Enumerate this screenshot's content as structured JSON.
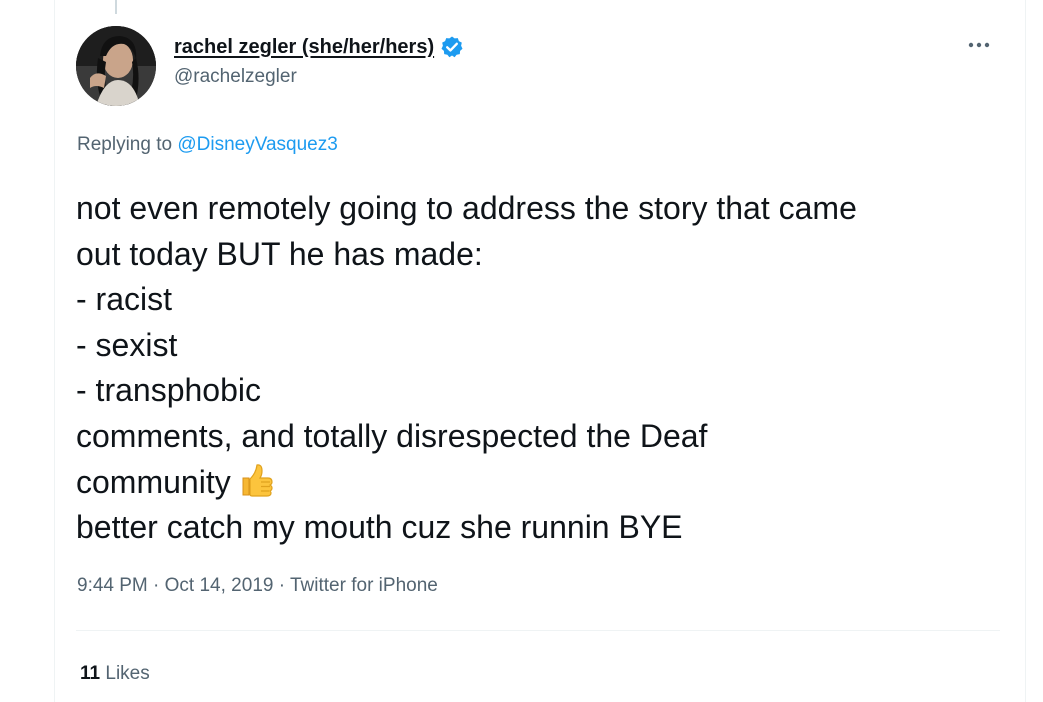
{
  "tweet": {
    "author": {
      "display_name": "rachel zegler (she/her/hers)",
      "handle": "@rachelzegler",
      "verified": true
    },
    "reply": {
      "prefix": "Replying to ",
      "mention": "@DisneyVasquez3"
    },
    "text": {
      "line1": "not even remotely going to address the story that came",
      "line2": "out today BUT he has made:",
      "line3": "- racist",
      "line4": "- sexist",
      "line5": "- transphobic",
      "line6": "comments, and totally disrespected the Deaf",
      "line7": "community",
      "line8": "better catch my mouth cuz she runnin BYE",
      "emoji": "thumbs-up-icon"
    },
    "meta": {
      "time": "9:44 PM",
      "separator1": " · ",
      "date": "Oct 14, 2019",
      "separator2": " · ",
      "source": "Twitter for iPhone"
    },
    "stats": {
      "likes_count": "11",
      "likes_label": " Likes"
    }
  },
  "colors": {
    "text_primary": "#0f1419",
    "text_secondary": "#536471",
    "accent": "#1d9bf0",
    "divider": "#eff3f4"
  }
}
